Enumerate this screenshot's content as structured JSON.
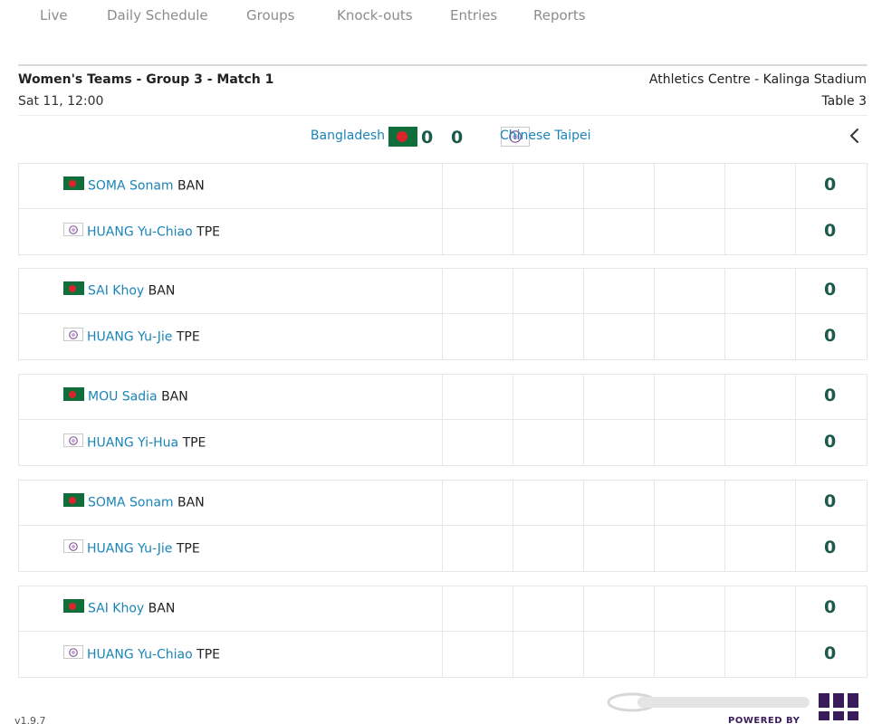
{
  "nav": {
    "tabs": [
      {
        "label": "Live"
      },
      {
        "label": "Daily Schedule"
      },
      {
        "label": "Groups"
      },
      {
        "label": "Knock-outs"
      },
      {
        "label": "Entries"
      },
      {
        "label": "Reports"
      }
    ]
  },
  "match": {
    "title": "Women's Teams - Group 3 - Match 1",
    "datetime": "Sat 11, 12:00",
    "venue": "Athletics Centre - Kalinga Stadium",
    "table": "Table 3"
  },
  "scoreline": {
    "home_team": "Bangladesh",
    "home_flag": "bangladesh-flag-icon",
    "home_score": "0",
    "away_team": "Chinese Taipei",
    "away_flag": "chinese-taipei-flag-icon",
    "away_score": "0",
    "back_icon": "chevron-left-icon"
  },
  "matches": [
    {
      "home": {
        "name": "SOMA Sonam",
        "nat": "BAN",
        "score": "0"
      },
      "away": {
        "name": "HUANG Yu-Chiao",
        "nat": "TPE",
        "score": "0"
      }
    },
    {
      "home": {
        "name": "SAI Khoy",
        "nat": "BAN",
        "score": "0"
      },
      "away": {
        "name": "HUANG Yu-Jie",
        "nat": "TPE",
        "score": "0"
      }
    },
    {
      "home": {
        "name": "MOU Sadia",
        "nat": "BAN",
        "score": "0"
      },
      "away": {
        "name": "HUANG Yi-Hua",
        "nat": "TPE",
        "score": "0"
      }
    },
    {
      "home": {
        "name": "SOMA Sonam",
        "nat": "BAN",
        "score": "0"
      },
      "away": {
        "name": "HUANG Yu-Jie",
        "nat": "TPE",
        "score": "0"
      }
    },
    {
      "home": {
        "name": "SAI Khoy",
        "nat": "BAN",
        "score": "0"
      },
      "away": {
        "name": "HUANG Yu-Chiao",
        "nat": "TPE",
        "score": "0"
      }
    }
  ],
  "footer": {
    "version": "v1.9.7",
    "powered_by": "POWERED BY"
  },
  "colors": {
    "link": "#1a84b8",
    "score": "#1c5a4a",
    "nav": "#8c8c8c",
    "bangladesh_green": "#0f6e3a",
    "bangladesh_red": "#d8262c"
  }
}
